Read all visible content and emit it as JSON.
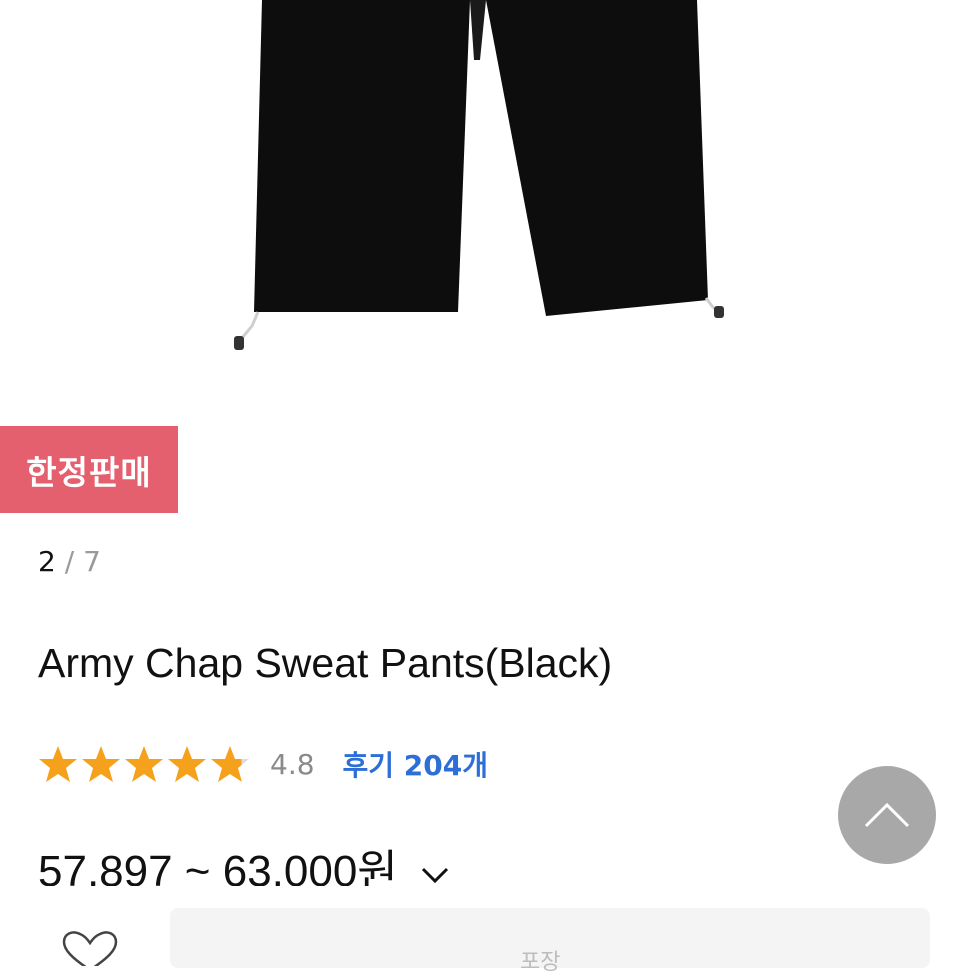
{
  "badge": {
    "label": "한정판매",
    "color": "#e5606f"
  },
  "pager": {
    "current": "2",
    "separator": "/",
    "total": "7"
  },
  "product": {
    "title": "Army Chap Sweat Pants(Black)"
  },
  "rating": {
    "stars": 4.8,
    "stars_max": 5,
    "score": "4.8",
    "reviews_label": "후기 204개",
    "star_color": "#f5a11c",
    "link_color": "#2d6fd6"
  },
  "price": {
    "range": "57,897 ~ 63,000원"
  },
  "bottom_bar": {
    "label": "포장"
  },
  "icons": {
    "scroll_top": "chevron-up-icon",
    "wish": "heart-outline-icon",
    "price_toggle": "chevron-down-icon"
  }
}
